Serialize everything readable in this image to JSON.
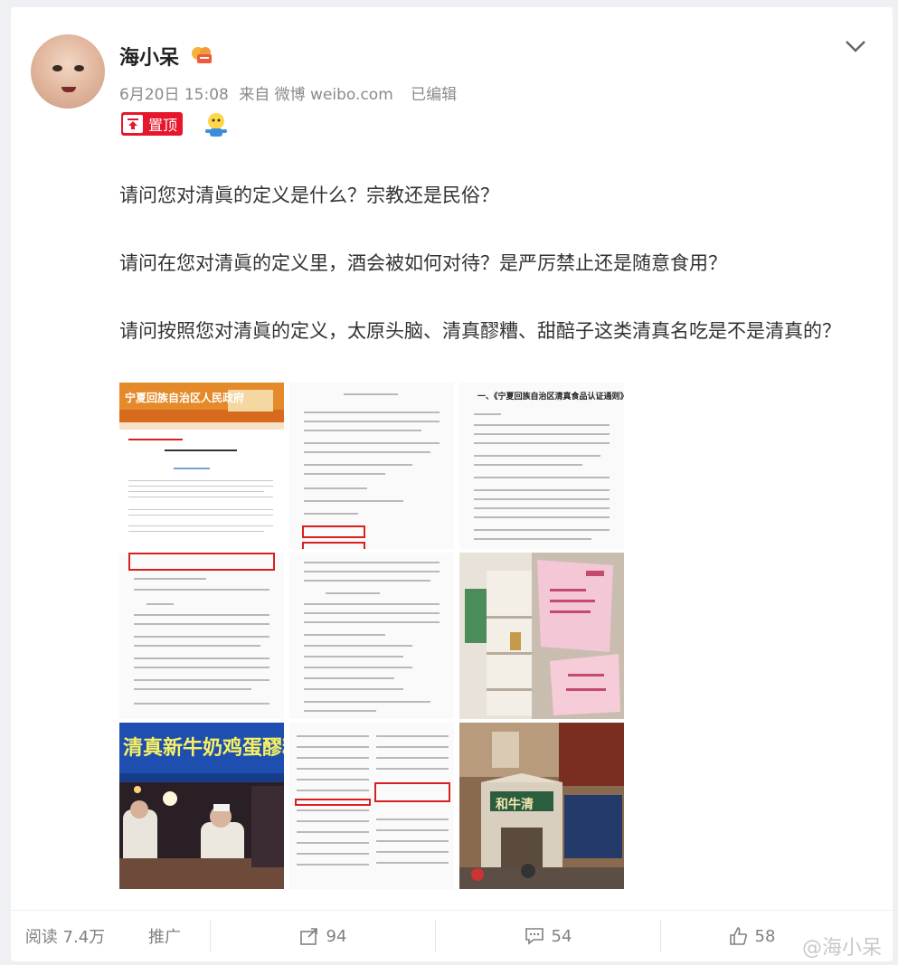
{
  "post": {
    "username": "海小呆",
    "time": "6月20日 15:08",
    "source": "来自 微博 weibo.com",
    "edited": "已编辑",
    "pinned_label": "置顶",
    "paragraphs": [
      "请问您对清眞的定义是什么？宗教还是民俗？",
      "请问在您对清眞的定义里，酒会被如何对待？是严厉禁止还是随意食用？",
      "请问按照您对清眞的定义，太原头脑、清真醪糟、甜醅子这类清真名吃是不是清真的？"
    ]
  },
  "images": {
    "banner_text": "宁夏回族自治区人民政府",
    "food_sign": "清真新牛奶鸡蛋醪糟",
    "doc_title": "一、《宁夏回族自治区清真食品认证通则》",
    "store_sign": "和牛清"
  },
  "actions": {
    "read_label": "阅读 7.4万",
    "promote_label": "推广",
    "repost_count": "94",
    "comment_count": "54",
    "like_count": "58"
  },
  "watermark": "@海小呆",
  "colors": {
    "accent": "#e6162d",
    "meta": "#8a8a8a"
  }
}
